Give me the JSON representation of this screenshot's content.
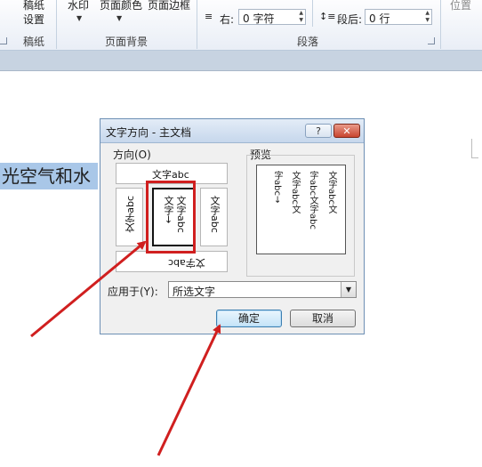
{
  "ribbon": {
    "page_setup_label": "稿纸\n设置",
    "page_setup_line1": "稿纸",
    "page_setup_line2": "设置",
    "group_manuscript": "稿纸",
    "watermark": "水印",
    "page_color": "页面颜色",
    "page_border": "页面边框",
    "group_page_background": "页面背景",
    "indent_right_label": "右:",
    "indent_right_value": "0 字符",
    "spacing_after_label": "段后:",
    "spacing_after_value": "0 行",
    "group_paragraph": "段落",
    "position": "位置"
  },
  "document": {
    "selected_text": "光空气和水"
  },
  "dialog": {
    "title": "文字方向 - 主文档",
    "help": "?",
    "close": "✕",
    "orientation_label": "方向(O)",
    "orientation_options": {
      "horizontal": "文字abc",
      "vertical_selected_col1": "文字abc",
      "vertical_selected_col2": "文字→",
      "rotated_left": "文字abc",
      "rotated_right": "文字abc",
      "upside_down": "文字abc"
    },
    "preview_label": "预览",
    "preview_columns": [
      "文字abc文",
      "字abc文字abc",
      "文字abc文",
      "字abc→"
    ],
    "apply_to_label": "应用于(Y):",
    "apply_to_value": "所选文字",
    "ok": "确定",
    "cancel": "取消"
  },
  "annotations": {
    "highlight_color": "#d01f1f"
  }
}
